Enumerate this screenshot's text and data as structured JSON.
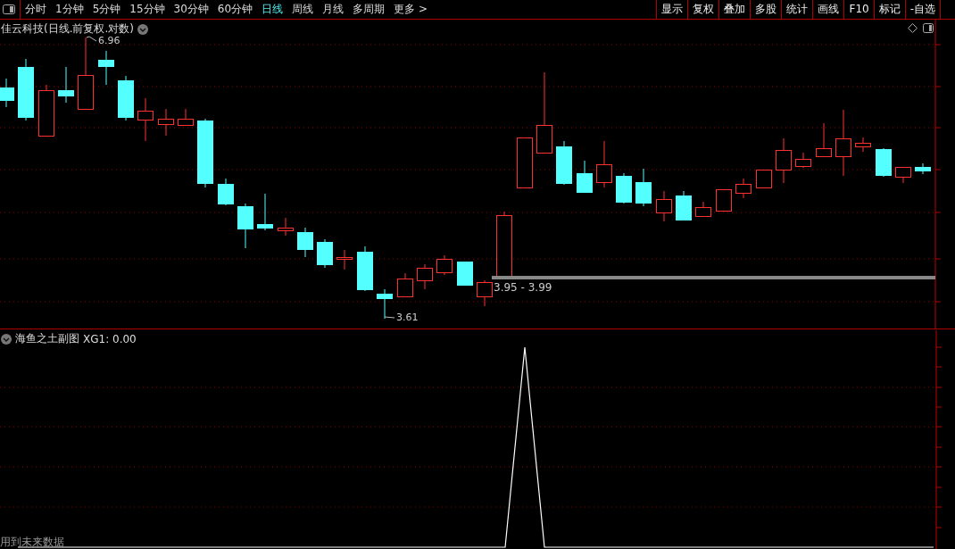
{
  "toolbar": {
    "periods": [
      {
        "label": "分时",
        "selected": false
      },
      {
        "label": "1分钟",
        "selected": false
      },
      {
        "label": "5分钟",
        "selected": false
      },
      {
        "label": "15分钟",
        "selected": false
      },
      {
        "label": "30分钟",
        "selected": false
      },
      {
        "label": "60分钟",
        "selected": false
      },
      {
        "label": "日线",
        "selected": true
      },
      {
        "label": "周线",
        "selected": false
      },
      {
        "label": "月线",
        "selected": false
      },
      {
        "label": "多周期",
        "selected": false
      }
    ],
    "more": "更多 >",
    "tools": [
      "显示",
      "复权",
      "叠加",
      "多股",
      "统计",
      "画线",
      "F10",
      "标记",
      "-自选"
    ]
  },
  "chart": {
    "title": "佳云科技(日线.前复权.对数)",
    "high_label": "6.96",
    "low_label": "3.61",
    "range_label": "3.95 - 3.99"
  },
  "indicator": {
    "title": "海鱼之土副图",
    "reading": "XG1: 0.00",
    "note": "用到未来数据"
  }
}
